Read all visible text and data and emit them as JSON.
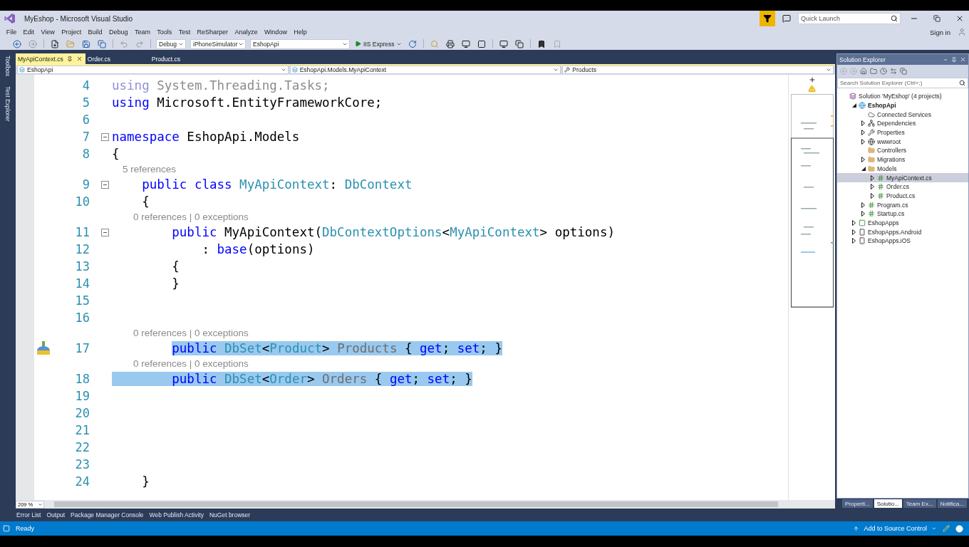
{
  "window": {
    "title": "MyEshop - Microsoft Visual Studio",
    "quick_launch": {
      "placeholder": "Quick Launch"
    }
  },
  "menu": [
    "File",
    "Edit",
    "View",
    "Project",
    "Build",
    "Debug",
    "Team",
    "Tools",
    "Test",
    "ReSharper",
    "Analyze",
    "Window",
    "Help"
  ],
  "account": {
    "sign_in": "Sign in"
  },
  "toolbar": {
    "configuration": "Debug",
    "platform": "iPhoneSimulator",
    "startup_project": "EshopApi",
    "run": "IIS Express"
  },
  "side_strip": [
    "Toolbox",
    "Test Explorer"
  ],
  "tabs": [
    {
      "label": "MyApiContext.cs",
      "selected": true
    },
    {
      "label": "Order.cs",
      "selected": false
    },
    {
      "label": "Product.cs",
      "selected": false
    }
  ],
  "navigation": [
    "EshopApi",
    "EshopApi.Models.MyApiContext",
    "Products"
  ],
  "editor": {
    "zoom": "209 %",
    "lines": [
      {
        "number": "4",
        "selected": false,
        "tokens": [
          {
            "kind": "keyword-faded",
            "text": "using"
          },
          {
            "kind": "plain-faded",
            "text": " System.Threading.Tasks;"
          }
        ]
      },
      {
        "number": "5",
        "selected": false,
        "tokens": [
          {
            "kind": "keyword",
            "text": "using"
          },
          {
            "kind": "plain",
            "text": " Microsoft.EntityFrameworkCore;"
          }
        ]
      },
      {
        "number": "6",
        "selected": false
      },
      {
        "number": "7",
        "selected": false,
        "expanded": true,
        "tokens": [
          {
            "kind": "keyword",
            "text": "namespace"
          },
          {
            "kind": "plain",
            "text": " EshopApi.Models"
          }
        ]
      },
      {
        "number": "8",
        "selected": false,
        "tokens": [
          {
            "kind": "plain",
            "text": "{"
          }
        ]
      },
      {
        "number": "9",
        "selected": false,
        "expanded": true,
        "lens": "5 references",
        "tokens": [
          {
            "kind": "keyword",
            "text": "    public"
          },
          {
            "kind": "keyword",
            "text": " class"
          },
          {
            "kind": "type",
            "text": " MyApiContext"
          },
          {
            "kind": "plain",
            "text": ": "
          },
          {
            "kind": "type",
            "text": "DbContext"
          }
        ]
      },
      {
        "number": "10",
        "selected": false,
        "tokens": [
          {
            "kind": "plain",
            "text": "    {"
          }
        ]
      },
      {
        "number": "11",
        "selected": false,
        "expanded": true,
        "lens": "0 references | 0 exceptions",
        "tokens": [
          {
            "kind": "keyword",
            "text": "        public"
          },
          {
            "kind": "plain",
            "text": " MyApiContext("
          },
          {
            "kind": "type",
            "text": "DbContextOptions"
          },
          {
            "kind": "plain",
            "text": "<"
          },
          {
            "kind": "type",
            "text": "MyApiContext"
          },
          {
            "kind": "plain",
            "text": "> options)"
          }
        ]
      },
      {
        "number": "12",
        "selected": false,
        "tokens": [
          {
            "kind": "plain",
            "text": "            : "
          },
          {
            "kind": "keyword",
            "text": "base"
          },
          {
            "kind": "plain",
            "text": "(options)"
          }
        ]
      },
      {
        "number": "13",
        "selected": false,
        "tokens": [
          {
            "kind": "plain",
            "text": "        {"
          }
        ]
      },
      {
        "number": "14",
        "selected": false,
        "tokens": [
          {
            "kind": "plain",
            "text": "        }"
          }
        ]
      },
      {
        "number": "15",
        "selected": false
      },
      {
        "number": "16",
        "selected": false
      },
      {
        "number": "17",
        "selected": false,
        "lens": "0 references | 0 exceptions",
        "quick_fix": true,
        "tokens": [
          {
            "kind": "keyword",
            "text": "        public",
            "selected": true
          },
          {
            "kind": "type",
            "text": " DbSet",
            "selected": true
          },
          {
            "kind": "plain",
            "text": "<",
            "selected": true
          },
          {
            "kind": "type",
            "text": "Product",
            "selected": true
          },
          {
            "kind": "plain",
            "text": "> ",
            "selected": true
          },
          {
            "kind": "member",
            "text": "Products",
            "selected": true
          },
          {
            "kind": "plain",
            "text": " { ",
            "selected": true
          },
          {
            "kind": "keyword",
            "text": "get",
            "selected": true
          },
          {
            "kind": "plain",
            "text": "; ",
            "selected": true
          },
          {
            "kind": "keyword",
            "text": "set",
            "selected": true
          },
          {
            "kind": "plain",
            "text": "; }",
            "selected": true
          }
        ]
      },
      {
        "number": "18",
        "selected": true,
        "lens": "0 references | 0 exceptions",
        "tokens": [
          {
            "kind": "keyword",
            "text": "        public"
          },
          {
            "kind": "type",
            "text": " DbSet"
          },
          {
            "kind": "plain",
            "text": "<"
          },
          {
            "kind": "type",
            "text": "Order"
          },
          {
            "kind": "plain",
            "text": "> "
          },
          {
            "kind": "member",
            "text": "Orders"
          },
          {
            "kind": "plain",
            "text": " { "
          },
          {
            "kind": "keyword",
            "text": "get"
          },
          {
            "kind": "plain",
            "text": "; "
          },
          {
            "kind": "keyword",
            "text": "set"
          },
          {
            "kind": "plain",
            "text": "; }"
          }
        ]
      },
      {
        "number": "19",
        "selected": false
      },
      {
        "number": "20",
        "selected": false
      },
      {
        "number": "21",
        "selected": false
      },
      {
        "number": "22",
        "selected": false
      },
      {
        "number": "23",
        "selected": false
      },
      {
        "number": "24",
        "selected": false,
        "tokens": [
          {
            "kind": "plain",
            "text": "    }"
          }
        ]
      }
    ]
  },
  "solution_explorer": {
    "title": "Solution Explorer",
    "search": {
      "placeholder": "Search Solution Explorer (Ctrl+;)"
    },
    "tree": [
      {
        "label": "Solution 'MyEshop' (4 projects)",
        "kind": "solution",
        "selected": false,
        "startup": false,
        "children": [
          {
            "label": "EshopApi",
            "kind": "web-project",
            "expanded": true,
            "selected": false,
            "startup": true,
            "children": [
              {
                "label": "Connected Services",
                "kind": "cloud",
                "selected": false,
                "startup": false
              },
              {
                "label": "Dependencies",
                "kind": "dependencies",
                "expanded": false,
                "selected": false,
                "startup": false
              },
              {
                "label": "Properties",
                "kind": "properties",
                "expanded": false,
                "selected": false,
                "startup": false
              },
              {
                "label": "wwwroot",
                "kind": "web-root",
                "expanded": false,
                "selected": false,
                "startup": false
              },
              {
                "label": "Controllers",
                "kind": "folder",
                "selected": false,
                "startup": false
              },
              {
                "label": "Migrations",
                "kind": "folder",
                "expanded": false,
                "selected": false,
                "startup": false
              },
              {
                "label": "Models",
                "kind": "folder",
                "expanded": true,
                "selected": false,
                "startup": false,
                "children": [
                  {
                    "label": "MyApiContext.cs",
                    "kind": "code-file",
                    "expanded": false,
                    "selected": true,
                    "startup": false
                  },
                  {
                    "label": "Order.cs",
                    "kind": "code-file",
                    "expanded": false,
                    "selected": false,
                    "startup": false
                  },
                  {
                    "label": "Product.cs",
                    "kind": "code-file",
                    "expanded": false,
                    "selected": false,
                    "startup": false
                  }
                ]
              },
              {
                "label": "Program.cs",
                "kind": "code-file",
                "expanded": false,
                "selected": false,
                "startup": false
              },
              {
                "label": "Startup.cs",
                "kind": "code-file",
                "expanded": false,
                "selected": false,
                "startup": false
              }
            ]
          },
          {
            "label": "EshopApps",
            "kind": "shared-project",
            "expanded": false,
            "selected": false,
            "startup": false
          },
          {
            "label": "EshopApps.Android",
            "kind": "device-project",
            "expanded": false,
            "selected": false,
            "startup": false
          },
          {
            "label": "EshopApps.iOS",
            "kind": "device-project",
            "expanded": false,
            "selected": false,
            "startup": false
          }
        ]
      }
    ]
  },
  "panel_tabs": [
    {
      "label": "Properti...",
      "selected": false
    },
    {
      "label": "Solutio...",
      "selected": true
    },
    {
      "label": "Team Ex...",
      "selected": false
    },
    {
      "label": "Notifica...",
      "selected": false
    }
  ],
  "bottom_tabs": [
    "Error List",
    "Output",
    "Package Manager Console",
    "Web Publish Activity",
    "NuGet browser"
  ],
  "status_bar": {
    "message": "Ready",
    "source_control": "Add to Source Control"
  }
}
